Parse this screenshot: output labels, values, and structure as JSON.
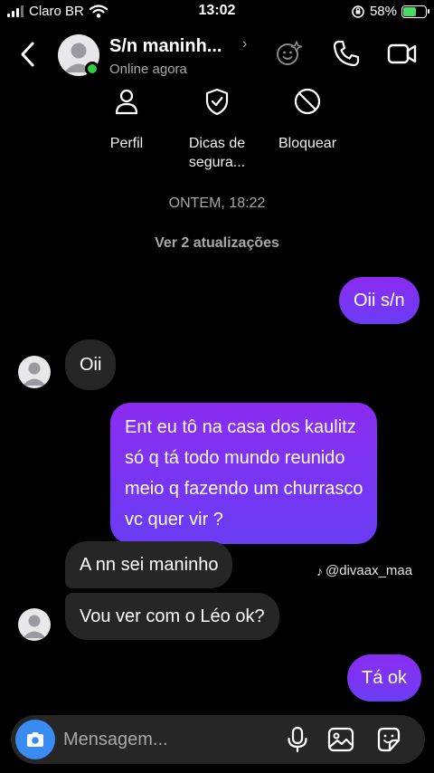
{
  "status_bar": {
    "carrier": "Claro BR",
    "time": "13:02",
    "battery_text": "58%",
    "battery_level": 0.58
  },
  "header": {
    "contact_name": "S/n maninh...",
    "status": "Online agora",
    "icons": [
      "back-chevron-icon",
      "avatar",
      "chevron-right-icon",
      "effects-icon",
      "phone-icon",
      "video-camera-icon"
    ]
  },
  "profile_actions": [
    {
      "label": "Perfil",
      "icon": "person-icon"
    },
    {
      "label": "Dicas de\nsegura...",
      "icon": "shield-check-icon"
    },
    {
      "label": "Bloquear",
      "icon": "block-icon"
    }
  ],
  "date_separator": "ONTEM, 18:22",
  "updates_link": "Ver 2 atualizações",
  "messages": [
    {
      "from": "me",
      "text": "Oii s/n"
    },
    {
      "from": "them",
      "text": "Oii"
    },
    {
      "from": "me",
      "lines": [
        "Ent eu tô na casa dos kaulitz",
        "só q tá todo mundo reunido",
        "meio q fazendo um churrasco",
        "vc quer vir ?"
      ]
    },
    {
      "from": "them",
      "text": "A nn sei maninho"
    },
    {
      "from": "them",
      "text": "Vou ver com o Léo ok?"
    },
    {
      "from": "me",
      "text": "Tá ok"
    }
  ],
  "watermark": "@divaax_maa",
  "composer": {
    "placeholder": "Mensagem...",
    "icons": [
      "camera-icon",
      "microphone-icon",
      "gallery-icon",
      "sticker-icon"
    ]
  },
  "colors": {
    "background": "#000000",
    "sent_bubble": "#7b2ff7",
    "received_bubble": "#262626",
    "camera_button": "#3a8cf2",
    "online_dot": "#2ecc40"
  }
}
